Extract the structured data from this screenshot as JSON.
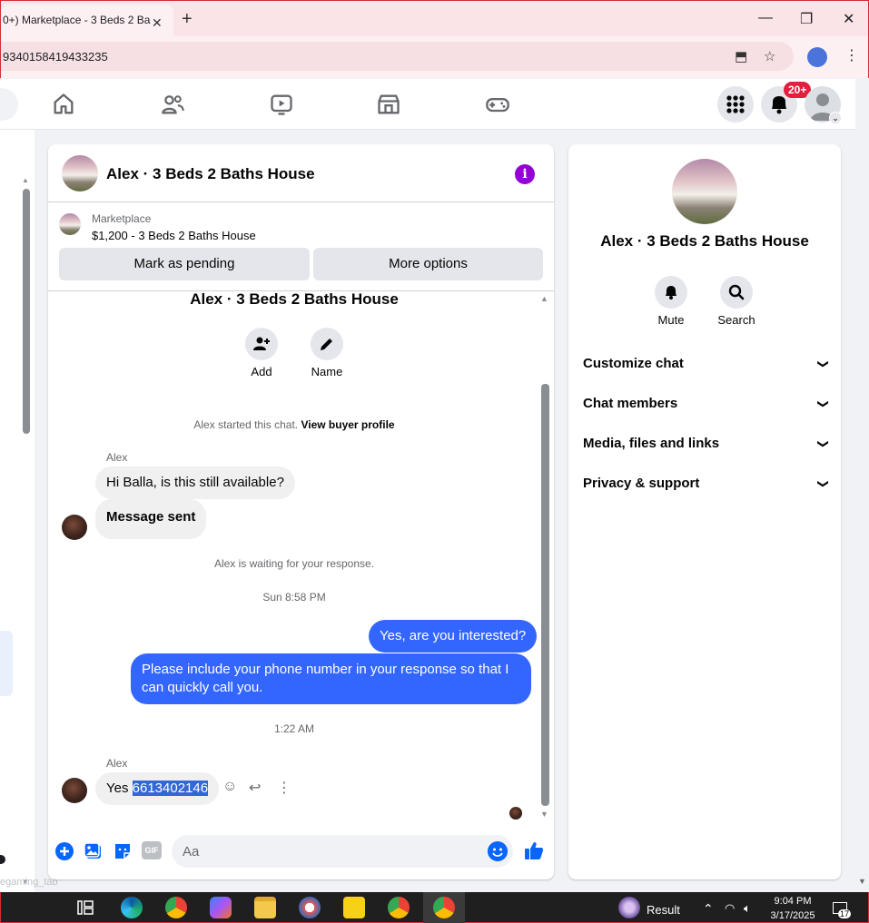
{
  "browser": {
    "tab_title": "0+) Marketplace - 3 Beds 2 Ba",
    "url": "9340158419433235"
  },
  "nav": {
    "notification_count": "20+"
  },
  "chat": {
    "header_title": "Alex · 3 Beds 2 Baths House",
    "listing_source": "Marketplace",
    "listing_price_title": "$1,200 - 3 Beds 2 Baths House",
    "mark_pending_label": "Mark as pending",
    "more_options_label": "More options",
    "convo_title": "Alex · 3 Beds 2 Baths House",
    "add_label": "Add",
    "name_label": "Name",
    "started_text": "Alex started this chat. ",
    "view_buyer_profile": "View buyer profile",
    "sender_name": "Alex",
    "msg_in_1": "Hi Balla, is this still available?",
    "msg_in_2": "Message sent",
    "waiting_text": "Alex is waiting for your response.",
    "time_1": "Sun 8:58 PM",
    "msg_out_1": "Yes, are you interested?",
    "msg_out_2": "Please include your phone number in your response so that I can quickly call you.",
    "time_2": "1:22 AM",
    "sender_name_2": "Alex",
    "msg_in_3_prefix": "Yes ",
    "msg_in_3_selected": "6613402146",
    "composer_placeholder": "Aa",
    "gif_label": "GIF"
  },
  "right_panel": {
    "title": "Alex · 3 Beds 2 Baths House",
    "mute_label": "Mute",
    "search_label": "Search",
    "sections": [
      "Customize chat",
      "Chat members",
      "Media, files and links",
      "Privacy & support"
    ]
  },
  "left": {
    "faded_label": "egaming_tab"
  },
  "taskbar": {
    "result_label": "Result",
    "time": "9:04 PM",
    "date": "3/17/2025",
    "notif_count": "17"
  },
  "colors": {
    "messenger_blue": "#3366ff",
    "fb_blue": "#0866ff",
    "info_purple": "#9400d3",
    "badge_red": "#e41e3f"
  }
}
